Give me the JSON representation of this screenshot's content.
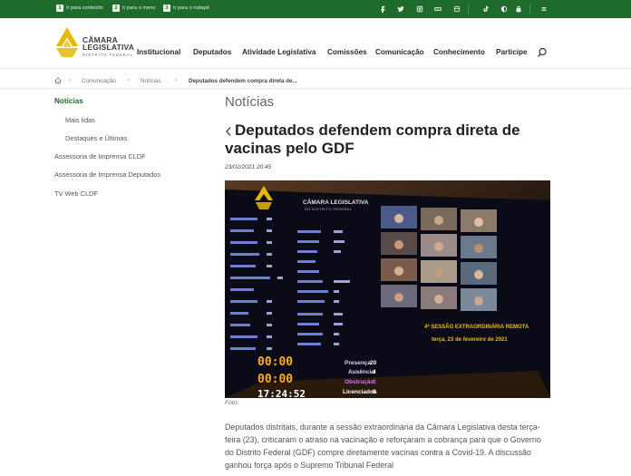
{
  "topbar": {
    "skip_links": [
      {
        "num": "1",
        "label": "Ir para conteúdo"
      },
      {
        "num": "2",
        "label": "Ir para o menu"
      },
      {
        "num": "3",
        "label": "Ir para o rodapé"
      }
    ],
    "icons": [
      "facebook-icon",
      "twitter-icon",
      "instagram-icon",
      "youtube-icon",
      "flickr-icon",
      "tiktok-icon",
      "accessibility-icon",
      "high-contrast-icon",
      "lock-icon",
      "menu-icon"
    ]
  },
  "header": {
    "logo_line1": "CÂMARA",
    "logo_line2": "LEGISLATIVA",
    "logo_line3": "DISTRITO FEDERAL",
    "nav": [
      "Institucional",
      "Deputados",
      "Atividade Legislativa",
      "Comissões",
      "Comunicação",
      "Conhecimento",
      "Participe"
    ]
  },
  "breadcrumb": {
    "items": [
      "Comunicação",
      "Notícias"
    ],
    "current": "Deputados defendem compra direta de..."
  },
  "sidebar": {
    "items": [
      {
        "label": "Notícias",
        "active": true
      },
      {
        "label": "Mais lidas",
        "active": false
      },
      {
        "label": "Destaques e Últimas",
        "active": false
      },
      {
        "label": "Assessoria de Imprensa CLDF",
        "active": false
      },
      {
        "label": "Assessoria de Imprensa Deputados",
        "active": false
      },
      {
        "label": "TV Web CLDF",
        "active": false
      }
    ]
  },
  "article": {
    "section": "Notícias",
    "title": "Deputados defendem compra direta de vacinas pelo GDF",
    "date": "23/02/2021 20:45",
    "caption": "Foto:",
    "body": "Deputados distritais, durante a sessão extraordinária da Câmara Legislativa desta terça-feira (23), criticaram o atraso na vacinação e reforçaram a cobrança para que o Governo do Distrito Federal (GDF) compre diretamente vacinas contra a Covid-19. A discussão ganhou força após o Supremo Tribunal Federal"
  },
  "photo": {
    "logo_line1": "CÂMARA LEGISLATIVA",
    "logo_line2": "DO DISTRITO FEDERAL",
    "session_line1": "4ª SESSÃO EXTRAORDINÁRIA REMOTA",
    "session_line2": "terça, 23 de fevereiro de 2021",
    "clock1": "00:00",
    "clock2": "00:00",
    "clock3": "17:24:52",
    "tallies": [
      {
        "label": "Presença",
        "value": "20"
      },
      {
        "label": "Ausência",
        "value": "4"
      },
      {
        "label": "Obstrução",
        "value": "0"
      },
      {
        "label": "Licenciados",
        "value": "0"
      }
    ]
  },
  "colors": {
    "brand_green": "#1f6b2b",
    "logo_gold": "#e8b800"
  }
}
